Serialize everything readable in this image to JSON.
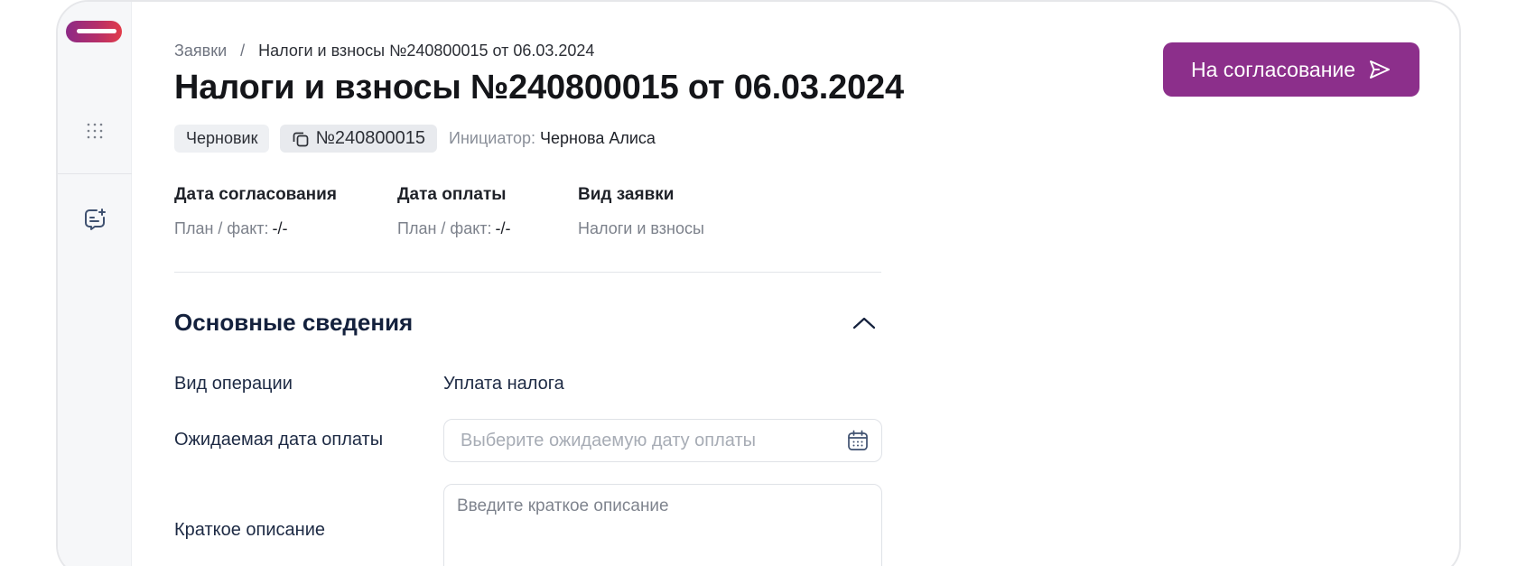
{
  "breadcrumb": {
    "root": "Заявки",
    "separator": "/",
    "current": "Налоги и взносы №240800015 от 06.03.2024"
  },
  "page": {
    "title": "Налоги и взносы №240800015 от 06.03.2024"
  },
  "status": {
    "badge": "Черновик",
    "number": "№240800015",
    "initiator_label": "Инициатор:",
    "initiator_name": "Чернова Алиса"
  },
  "dates": {
    "approval": {
      "label": "Дата согласования",
      "sub_label": "План / факт:",
      "value": "-/-"
    },
    "payment": {
      "label": "Дата оплаты",
      "sub_label": "План / факт:",
      "value": "-/-"
    },
    "request_type": {
      "label": "Вид заявки",
      "value": "Налоги и взносы"
    }
  },
  "section": {
    "title": "Основные сведения"
  },
  "fields": {
    "operation_type": {
      "label": "Вид операции",
      "value": "Уплата налога"
    },
    "expected_date": {
      "label": "Ожидаемая дата оплаты",
      "placeholder": "Выберите ожидаемую дату оплаты",
      "value": ""
    },
    "short_description": {
      "label": "Краткое описание",
      "placeholder": "Введите краткое описание",
      "value": ""
    }
  },
  "actions": {
    "submit_label": "На согласование"
  },
  "icons": {
    "grid": "grid-dots-icon",
    "comments": "comment-add-icon",
    "copy": "copy-icon",
    "chevron": "chevron-up-icon",
    "calendar": "calendar-icon",
    "send": "send-icon"
  },
  "colors": {
    "accent": "#8c2f8b",
    "heading": "#14213d",
    "sidebar_bg": "#f6f7f9",
    "chip_bg": "#eef0f3"
  }
}
